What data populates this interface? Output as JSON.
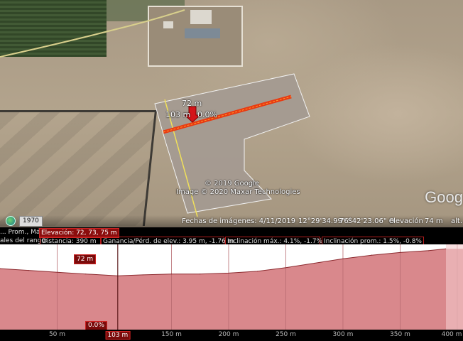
{
  "map": {
    "measure_distance": "72 m",
    "measure_position": "103 m",
    "measure_slope": "0.0%",
    "copyright_1": "© 2019 Google",
    "copyright_2": "Image © 2020 Maxar Technologies",
    "logo": "Goog"
  },
  "status_bar": {
    "year": "1970",
    "imagery_date": "Fechas de imágenes: 4/11/2019",
    "latitude": "12°29'34.99\" S",
    "longitude": "76°42'23.06\" O",
    "elevation_label": "elevación",
    "elevation_value": "74 m",
    "altitude_label": "alt."
  },
  "profile_stats": {
    "row1_label": "... Prom., Máx.",
    "elevation": "Elevación: 72, 73, 75 m",
    "row2_label": "ales del rango:",
    "distance": "Distancia: 390 m",
    "gain_loss": "Ganancia/Pérd. de elev.: 3.95 m, -1.76 m",
    "max_slope": "Inclinación máx.: 4.1%, -1.7%",
    "avg_slope": "Inclinación prom.: 1.5%, -0.8%"
  },
  "profile": {
    "cursor_elevation": "72 m",
    "cursor_slope": "0.0%",
    "fill_color": "#d9888c",
    "line_color": "#ffffff"
  },
  "chart_data": {
    "type": "area",
    "xlabel": "",
    "ylabel": "",
    "x": [
      0,
      25,
      50,
      75,
      103,
      125,
      150,
      175,
      200,
      225,
      250,
      275,
      300,
      325,
      350,
      375,
      390
    ],
    "y": [
      72.8,
      72.6,
      72.4,
      72.2,
      72.0,
      72.1,
      72.2,
      72.2,
      72.3,
      72.5,
      72.9,
      73.4,
      73.9,
      74.3,
      74.6,
      74.8,
      75.0
    ],
    "xlim": [
      0,
      405
    ],
    "ylim": [
      66,
      75.5
    ],
    "x_ticks": [
      "50 m",
      "103 m",
      "150 m",
      "200 m",
      "250 m",
      "300 m",
      "350 m",
      "400 m"
    ],
    "x_tick_values": [
      50,
      103,
      150,
      200,
      250,
      300,
      350,
      400
    ],
    "cursor_x": 103
  }
}
